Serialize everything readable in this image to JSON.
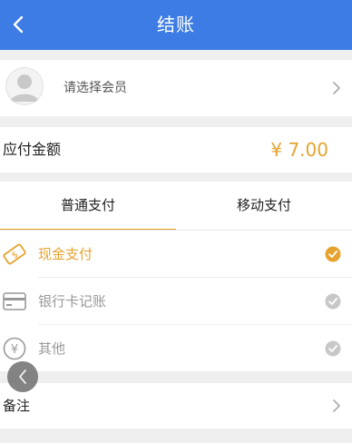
{
  "header": {
    "title": "结账"
  },
  "member": {
    "placeholder": "请选择会员"
  },
  "amount": {
    "label": "应付金额",
    "value": "¥ 7.00"
  },
  "tabs": [
    {
      "label": "普通支付",
      "active": true
    },
    {
      "label": "移动支付",
      "active": false
    }
  ],
  "payment_methods": [
    {
      "label": "现金支付",
      "icon": "cash-ticket-icon",
      "selected": true
    },
    {
      "label": "银行卡记账",
      "icon": "bank-card-icon",
      "selected": false
    },
    {
      "label": "其他",
      "icon": "yen-circle-icon",
      "selected": false
    }
  ],
  "remark": {
    "label": "备注"
  },
  "colors": {
    "header_bg": "#3d7ce4",
    "accent": "#e6a330",
    "muted_text": "#999999",
    "page_bg": "#efefef"
  }
}
